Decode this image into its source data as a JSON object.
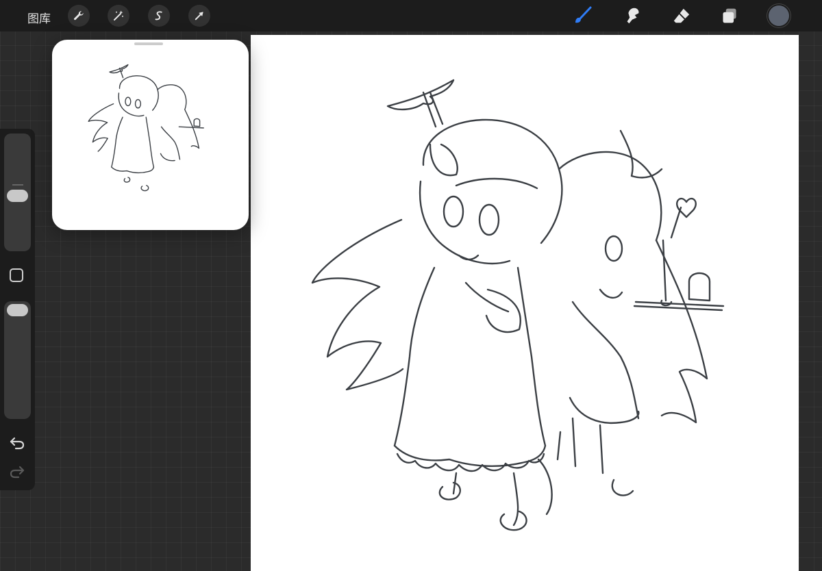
{
  "topbar": {
    "gallery_label": "图库",
    "left_tools": [
      "actions-wrench-icon",
      "adjustments-wand-icon",
      "selection-icon",
      "transform-arrow-icon"
    ],
    "right_tools": [
      "brush-icon",
      "smudge-icon",
      "eraser-icon",
      "layers-icon"
    ],
    "active_tool": "brush-icon",
    "accent_color": "#2f7cf6",
    "current_color": "#5c6370"
  },
  "sidebar": {
    "controls": [
      "brush-size-slider",
      "modify-button",
      "opacity-slider",
      "undo-icon",
      "redo-icon"
    ]
  },
  "colors": {
    "topbar_bg": "#1c1c1c",
    "workspace_bg": "#2b2b2b",
    "canvas_bg": "#ffffff",
    "line_art": "#3b3f44"
  }
}
